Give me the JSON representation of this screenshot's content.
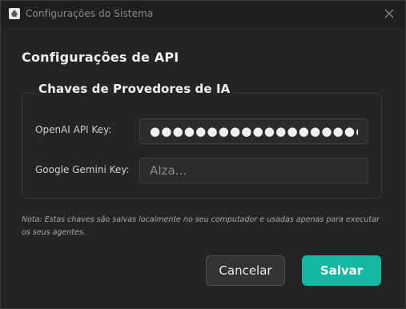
{
  "window": {
    "title": "Configurações do Sistema",
    "icons": {
      "app": "app-logo-icon",
      "close": "close-icon"
    }
  },
  "main": {
    "heading": "Configurações de API",
    "group": {
      "title": "Chaves de Provedores de IA",
      "fields": {
        "openai": {
          "label": "OpenAI API Key:",
          "value": "●●●●●●●●●●●●●●●●●●●●●●",
          "masked": true
        },
        "gemini": {
          "label": "Google Gemini Key:",
          "value": "",
          "placeholder": "AIza..."
        }
      }
    },
    "note": "Nota: Estas chaves são salvas localmente no seu computador e usadas apenas para executar os seus agentes."
  },
  "buttons": {
    "cancel": "Cancelar",
    "save": "Salvar"
  },
  "colors": {
    "accent": "#14b8a0",
    "background": "#242424",
    "input_background": "#2b2b2b"
  }
}
